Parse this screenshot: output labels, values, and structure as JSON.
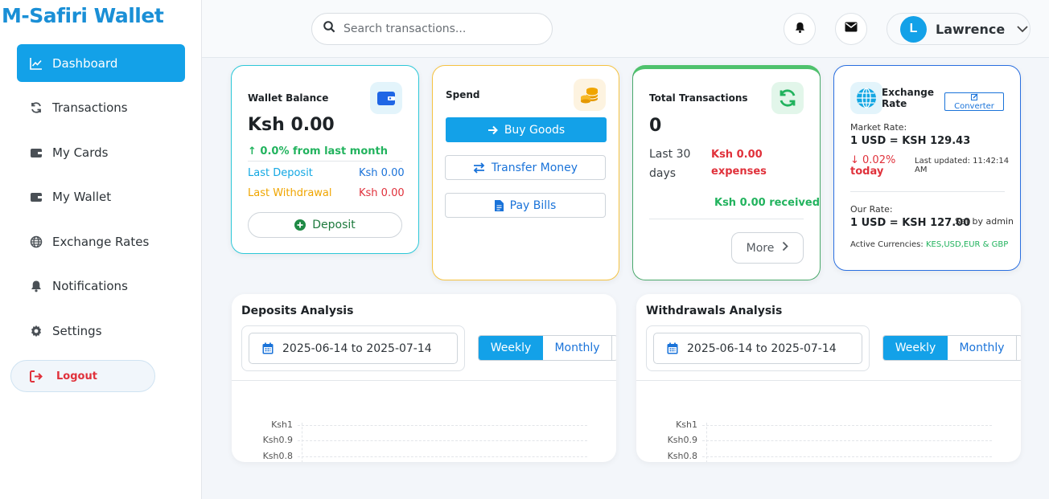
{
  "brand": "M-Safiri Wallet",
  "sidebar": {
    "items": [
      {
        "label": "Dashboard",
        "icon": "chart-line-icon",
        "active": true
      },
      {
        "label": "Transactions",
        "icon": "sync-icon"
      },
      {
        "label": "My Cards",
        "icon": "wallet-icon"
      },
      {
        "label": "My Wallet",
        "icon": "wallet-icon"
      },
      {
        "label": "Exchange Rates",
        "icon": "globe-icon"
      },
      {
        "label": "Notifications",
        "icon": "bell-icon"
      },
      {
        "label": "Settings",
        "icon": "gear-icon"
      }
    ],
    "logout": "Logout"
  },
  "header": {
    "search_placeholder": "Search transactions...",
    "user": {
      "initial": "L",
      "name": "Lawrence"
    }
  },
  "wallet": {
    "title": "Wallet Balance",
    "balance": "Ksh 0.00",
    "change": "↑ 0.0% from last month",
    "last_deposit_label": "Last Deposit",
    "last_deposit_value": "Ksh 0.00",
    "last_withdrawal_label": "Last Withdrawal",
    "last_withdrawal_value": "Ksh 0.00",
    "deposit_button": "Deposit"
  },
  "spend": {
    "title": "Spend",
    "buy_goods": "Buy Goods",
    "transfer_money": "Transfer Money",
    "pay_bills": "Pay Bills"
  },
  "transactions": {
    "title": "Total Transactions",
    "count": "0",
    "period_line1": "Last 30",
    "period_line2": "days",
    "expenses_line1": "Ksh 0.00",
    "expenses_line2": "expenses",
    "received": "Ksh 0.00 received",
    "more_button": "More"
  },
  "exchange": {
    "title_line1": "Exchange",
    "title_line2": "Rate",
    "converter_button": "Converter",
    "market_label": "Market Rate:",
    "market_value": "1 USD = KSH 129.43",
    "change_line1": "↓ 0.02%",
    "change_line2": "today",
    "updated_line1": "Last updated: 11:42:14",
    "updated_line2": "AM",
    "our_label": "Our Rate:",
    "our_value": "1 USD = KSH 127.00",
    "set_by": "Set by admin",
    "active_label": "Active Currencies:",
    "active_value": "KES,USD,EUR & GBP"
  },
  "deposits_panel": {
    "title": "Deposits Analysis",
    "range": "2025-06-14 to 2025-07-14",
    "weekly": "Weekly",
    "monthly": "Monthly",
    "ticks": [
      "Ksh1",
      "Ksh0.9",
      "Ksh0.8"
    ]
  },
  "withdrawals_panel": {
    "title": "Withdrawals Analysis",
    "range": "2025-06-14 to 2025-07-14",
    "weekly": "Weekly",
    "monthly": "Monthly",
    "ticks": [
      "Ksh1",
      "Ksh0.9",
      "Ksh0.8"
    ]
  },
  "colors": {
    "primary": "#13a1e8",
    "success": "#22b35e",
    "danger": "#e0313b",
    "warning": "#f0a500"
  }
}
